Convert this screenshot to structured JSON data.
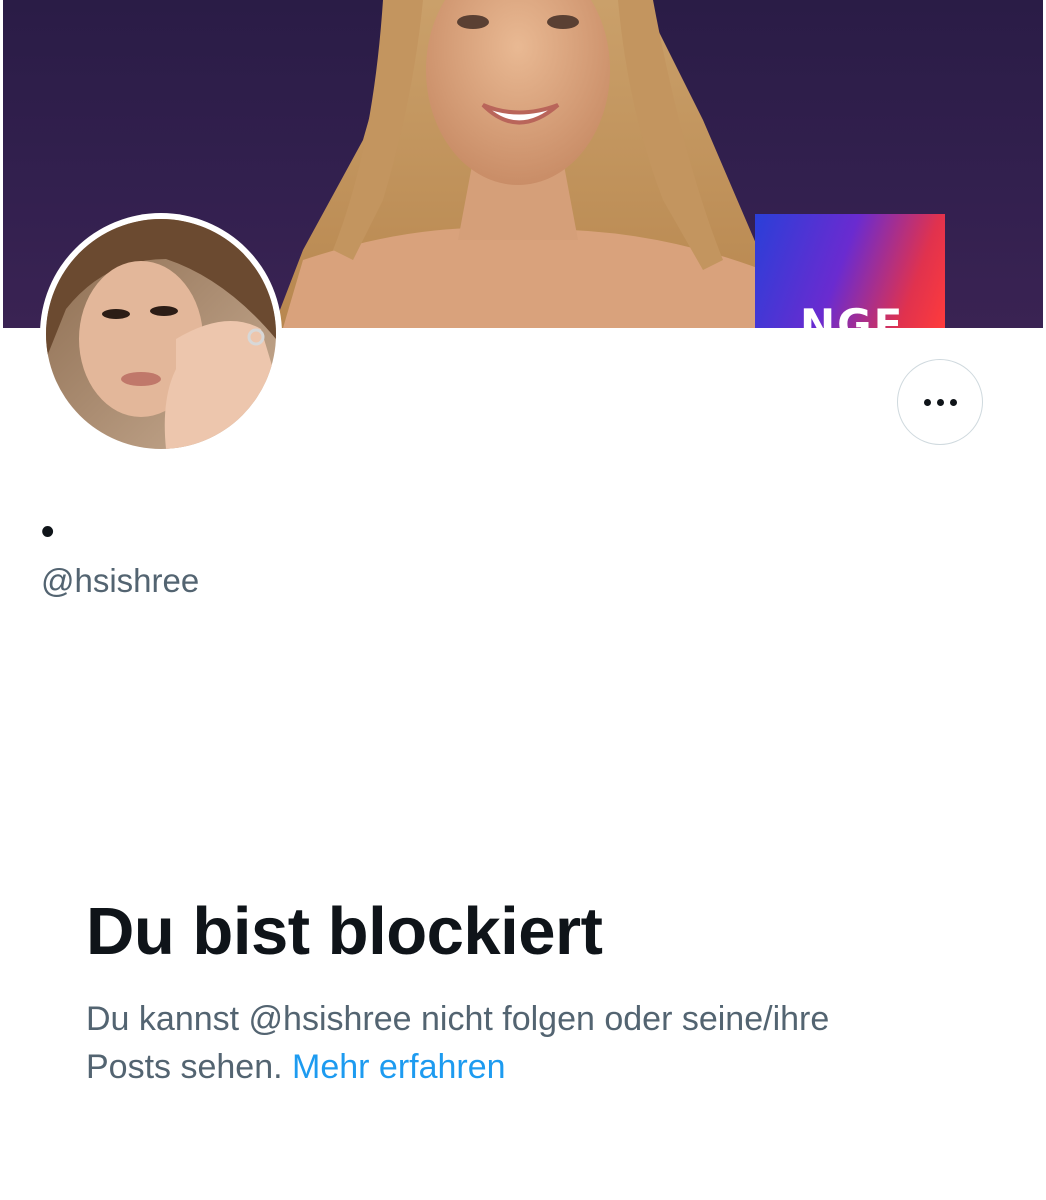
{
  "profile": {
    "display_name": "•",
    "handle": "@hsishree"
  },
  "banner": {
    "sign_text": "NGE"
  },
  "header": {
    "more_button_label": "More",
    "more_icon": "more-horizontal-icon"
  },
  "blocked": {
    "title": "Du bist blockiert",
    "text_line1": "Du kannst @hsishree nicht folgen oder seine/ihre",
    "text_line2": "Posts sehen.",
    "learn_more": "Mehr erfahren"
  },
  "colors": {
    "text_primary": "#0f1419",
    "text_secondary": "#536471",
    "link": "#1d9bf0",
    "border": "#cfd9de"
  }
}
